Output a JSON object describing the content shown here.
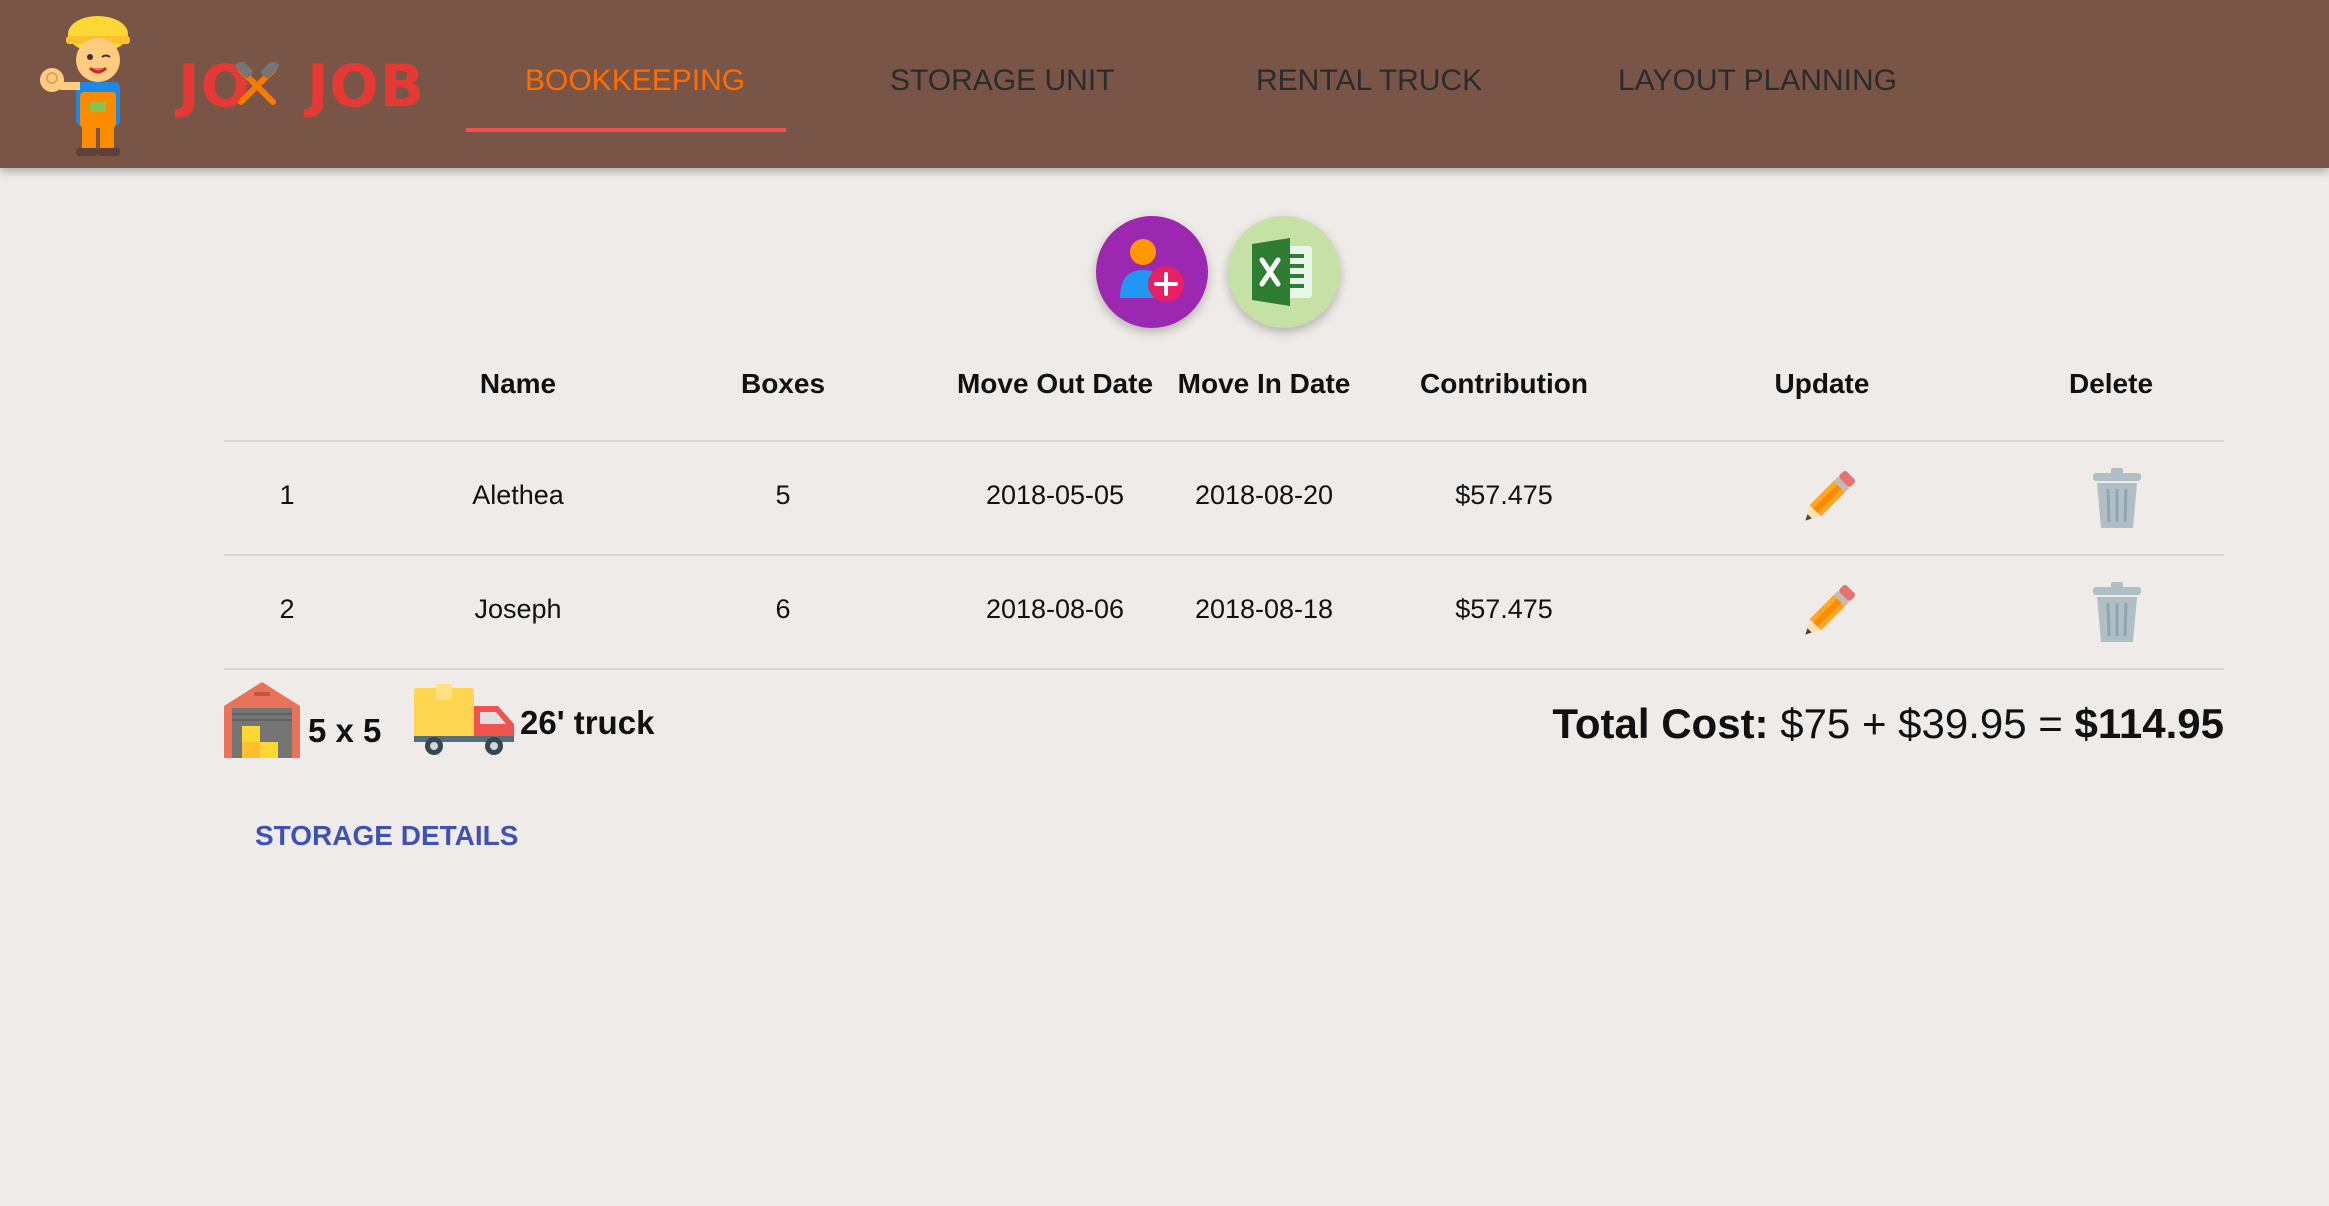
{
  "app": {
    "logo": {
      "text_left": "JO",
      "text_right": "JOB"
    }
  },
  "tabs": [
    {
      "label": "BOOKKEEPING",
      "active": true
    },
    {
      "label": "STORAGE UNIT",
      "active": false
    },
    {
      "label": "RENTAL TRUCK",
      "active": false
    },
    {
      "label": "LAYOUT PLANNING",
      "active": false
    }
  ],
  "actions": {
    "add_person_icon": "add-person-icon",
    "excel_icon": "excel-icon"
  },
  "table": {
    "headers": {
      "name": "Name",
      "boxes": "Boxes",
      "move_out": "Move Out Date",
      "move_in": "Move In Date",
      "contribution": "Contribution",
      "update": "Update",
      "delete": "Delete"
    },
    "rows": [
      {
        "index": "1",
        "name": "Alethea",
        "boxes": "5",
        "move_out": "2018-05-05",
        "move_in": "2018-08-20",
        "contribution": "$57.475"
      },
      {
        "index": "2",
        "name": "Joseph",
        "boxes": "6",
        "move_out": "2018-08-06",
        "move_in": "2018-08-18",
        "contribution": "$57.475"
      }
    ]
  },
  "summary": {
    "storage_size": "5 x 5",
    "truck": "26' truck",
    "total_label": "Total Cost:",
    "total_expr": " $75 + $39.95 = ",
    "total_value": "$114.95"
  },
  "links": {
    "storage_details": "STORAGE DETAILS"
  },
  "colors": {
    "appbar": "#795548",
    "active_tab": "#ff6d00",
    "tab_indicator": "#ef5350",
    "background": "#efebe9",
    "link": "#3f51b5",
    "fab_add": "#9c27b0",
    "fab_excel": "#c5e1a5"
  }
}
